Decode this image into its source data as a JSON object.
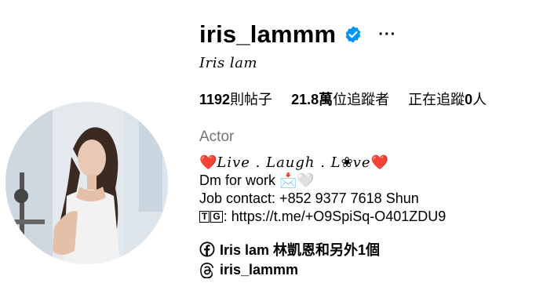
{
  "profile": {
    "username": "iris_lammm",
    "verified": true,
    "full_name": "Iris lam",
    "stats": {
      "posts_count": "1192",
      "posts_label": "則帖子",
      "followers_count": "21.8萬",
      "followers_label": "位追蹤者",
      "following_prefix": "正在追蹤",
      "following_count": "0",
      "following_suffix": "人"
    },
    "category": "Actor",
    "bio": {
      "line1_heart_left": "❤️",
      "line1_text_a": "𝐿𝑖𝑣𝑒 . 𝐿𝑎𝑢𝑔ℎ . 𝐿",
      "line1_flower": "❀",
      "line1_text_b": "𝑣𝑒",
      "line1_heart_right": "❤️",
      "line2": "Dm for work 📩🤍",
      "line3": "Job contact: +852 9377 7618 Shun",
      "line4_box1": "T",
      "line4_box2": "G",
      "line4_text": ": https://t.me/+O9SpiSq-O401ZDU9"
    },
    "facebook_link": "Iris lam 林凱恩和另外1個",
    "threads_link": "iris_lammm"
  },
  "icons": {
    "verified": "verified-badge-icon",
    "more": "more-options-icon",
    "facebook": "facebook-icon",
    "threads": "threads-icon"
  },
  "colors": {
    "verified_blue": "#0095f6",
    "muted_text": "#737373",
    "heart_red": "#d81e2d"
  }
}
